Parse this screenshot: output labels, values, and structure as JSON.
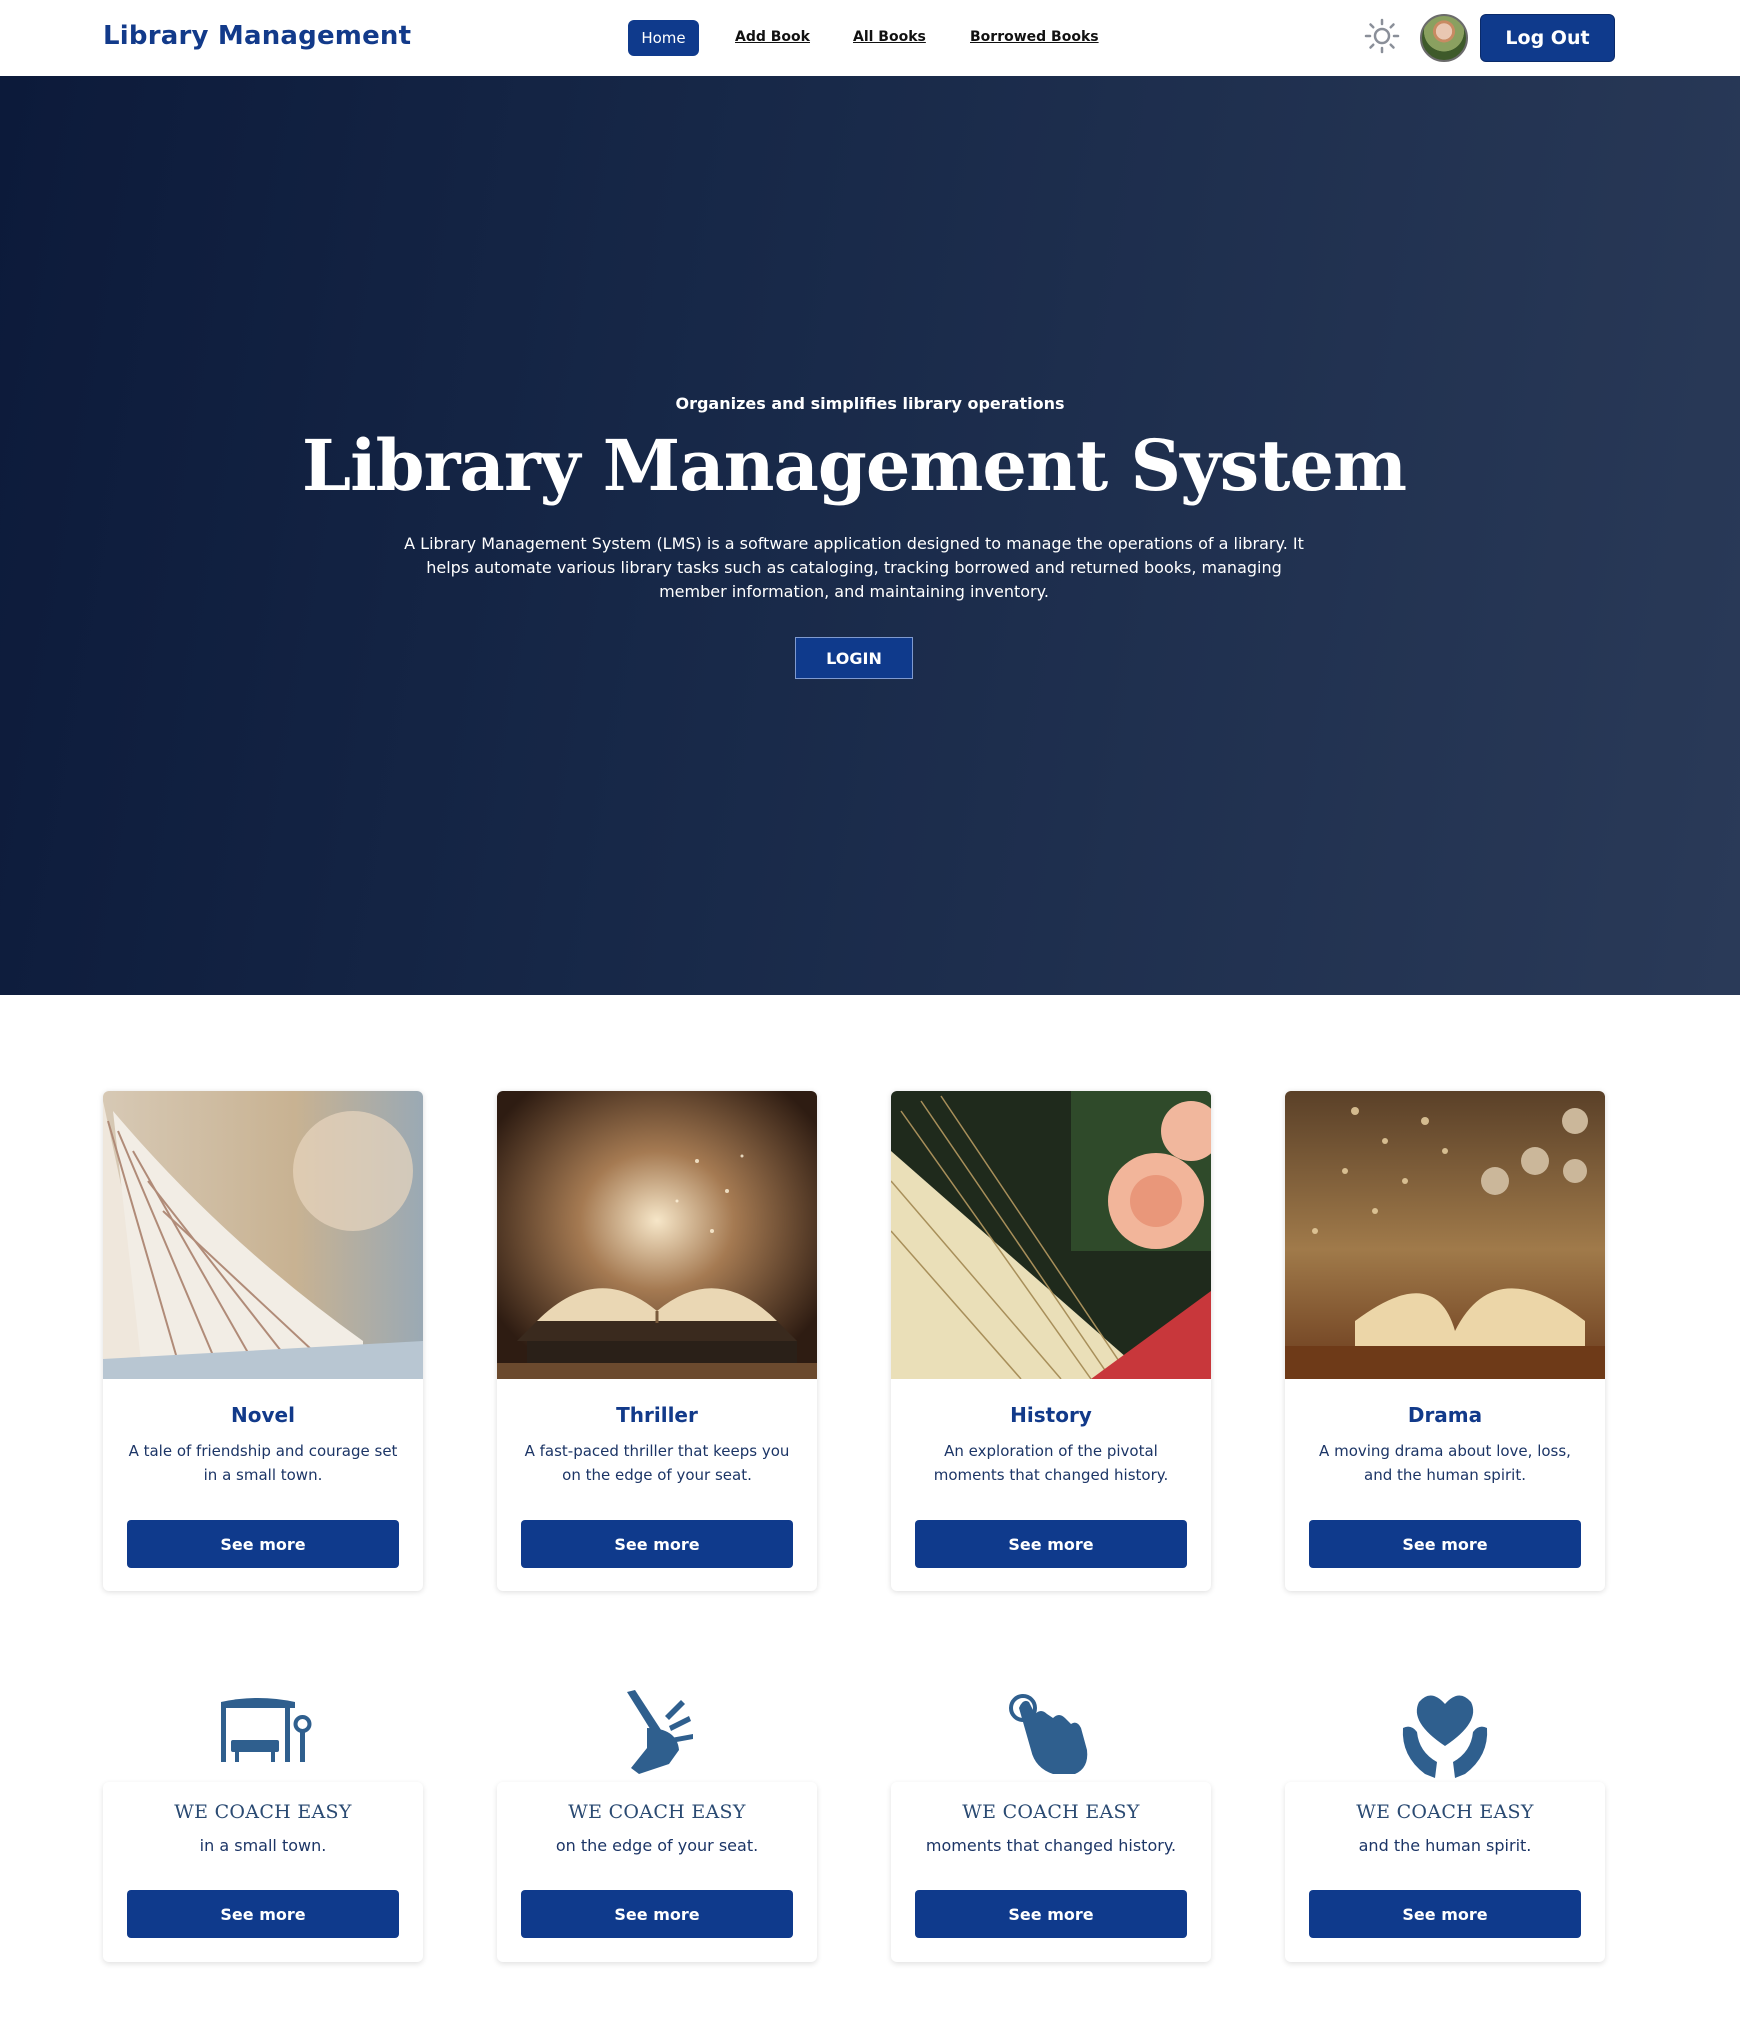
{
  "navbar": {
    "brand": "Library Management",
    "links": [
      "Home",
      "Add Book",
      "All Books",
      "Borrowed Books"
    ],
    "logout_label": "Log Out",
    "theme_icon": "sun-icon"
  },
  "hero": {
    "eyebrow": "Organizes and simplifies library operations",
    "title": "Library Management System",
    "description": "A Library Management System (LMS) is a software application designed to manage the operations of a library. It helps automate various library tasks such as cataloging, tracking borrowed and returned books, managing member information, and maintaining inventory.",
    "login_label": "LOGIN"
  },
  "categories": [
    {
      "title": "Novel",
      "description": "A tale of friendship and courage set in a small town.",
      "button": "See more"
    },
    {
      "title": "Thriller",
      "description": "A fast-paced thriller that keeps you on the edge of your seat.",
      "button": "See more"
    },
    {
      "title": "History",
      "description": "An exploration of the pivotal moments that changed history.",
      "button": "See more"
    },
    {
      "title": "Drama",
      "description": "A moving drama about love, loss, and the human spirit.",
      "button": "See more"
    }
  ],
  "features": [
    {
      "icon": "bus-stop-icon",
      "title": "WE COACH EASY",
      "description": "in a small town.",
      "button": "See more"
    },
    {
      "icon": "hand-wave-icon",
      "title": "WE COACH EASY",
      "description": "on the edge of your seat.",
      "button": "See more"
    },
    {
      "icon": "tap-hand-icon",
      "title": "WE COACH EASY",
      "description": "moments that changed history.",
      "button": "See more"
    },
    {
      "icon": "heart-hands-icon",
      "title": "WE COACH EASY",
      "description": "and the human spirit.",
      "button": "See more"
    }
  ],
  "colors": {
    "primary": "#0f3a8c",
    "hero_dark": "#0c1a3a",
    "icon_blue": "#2f5f8e"
  }
}
